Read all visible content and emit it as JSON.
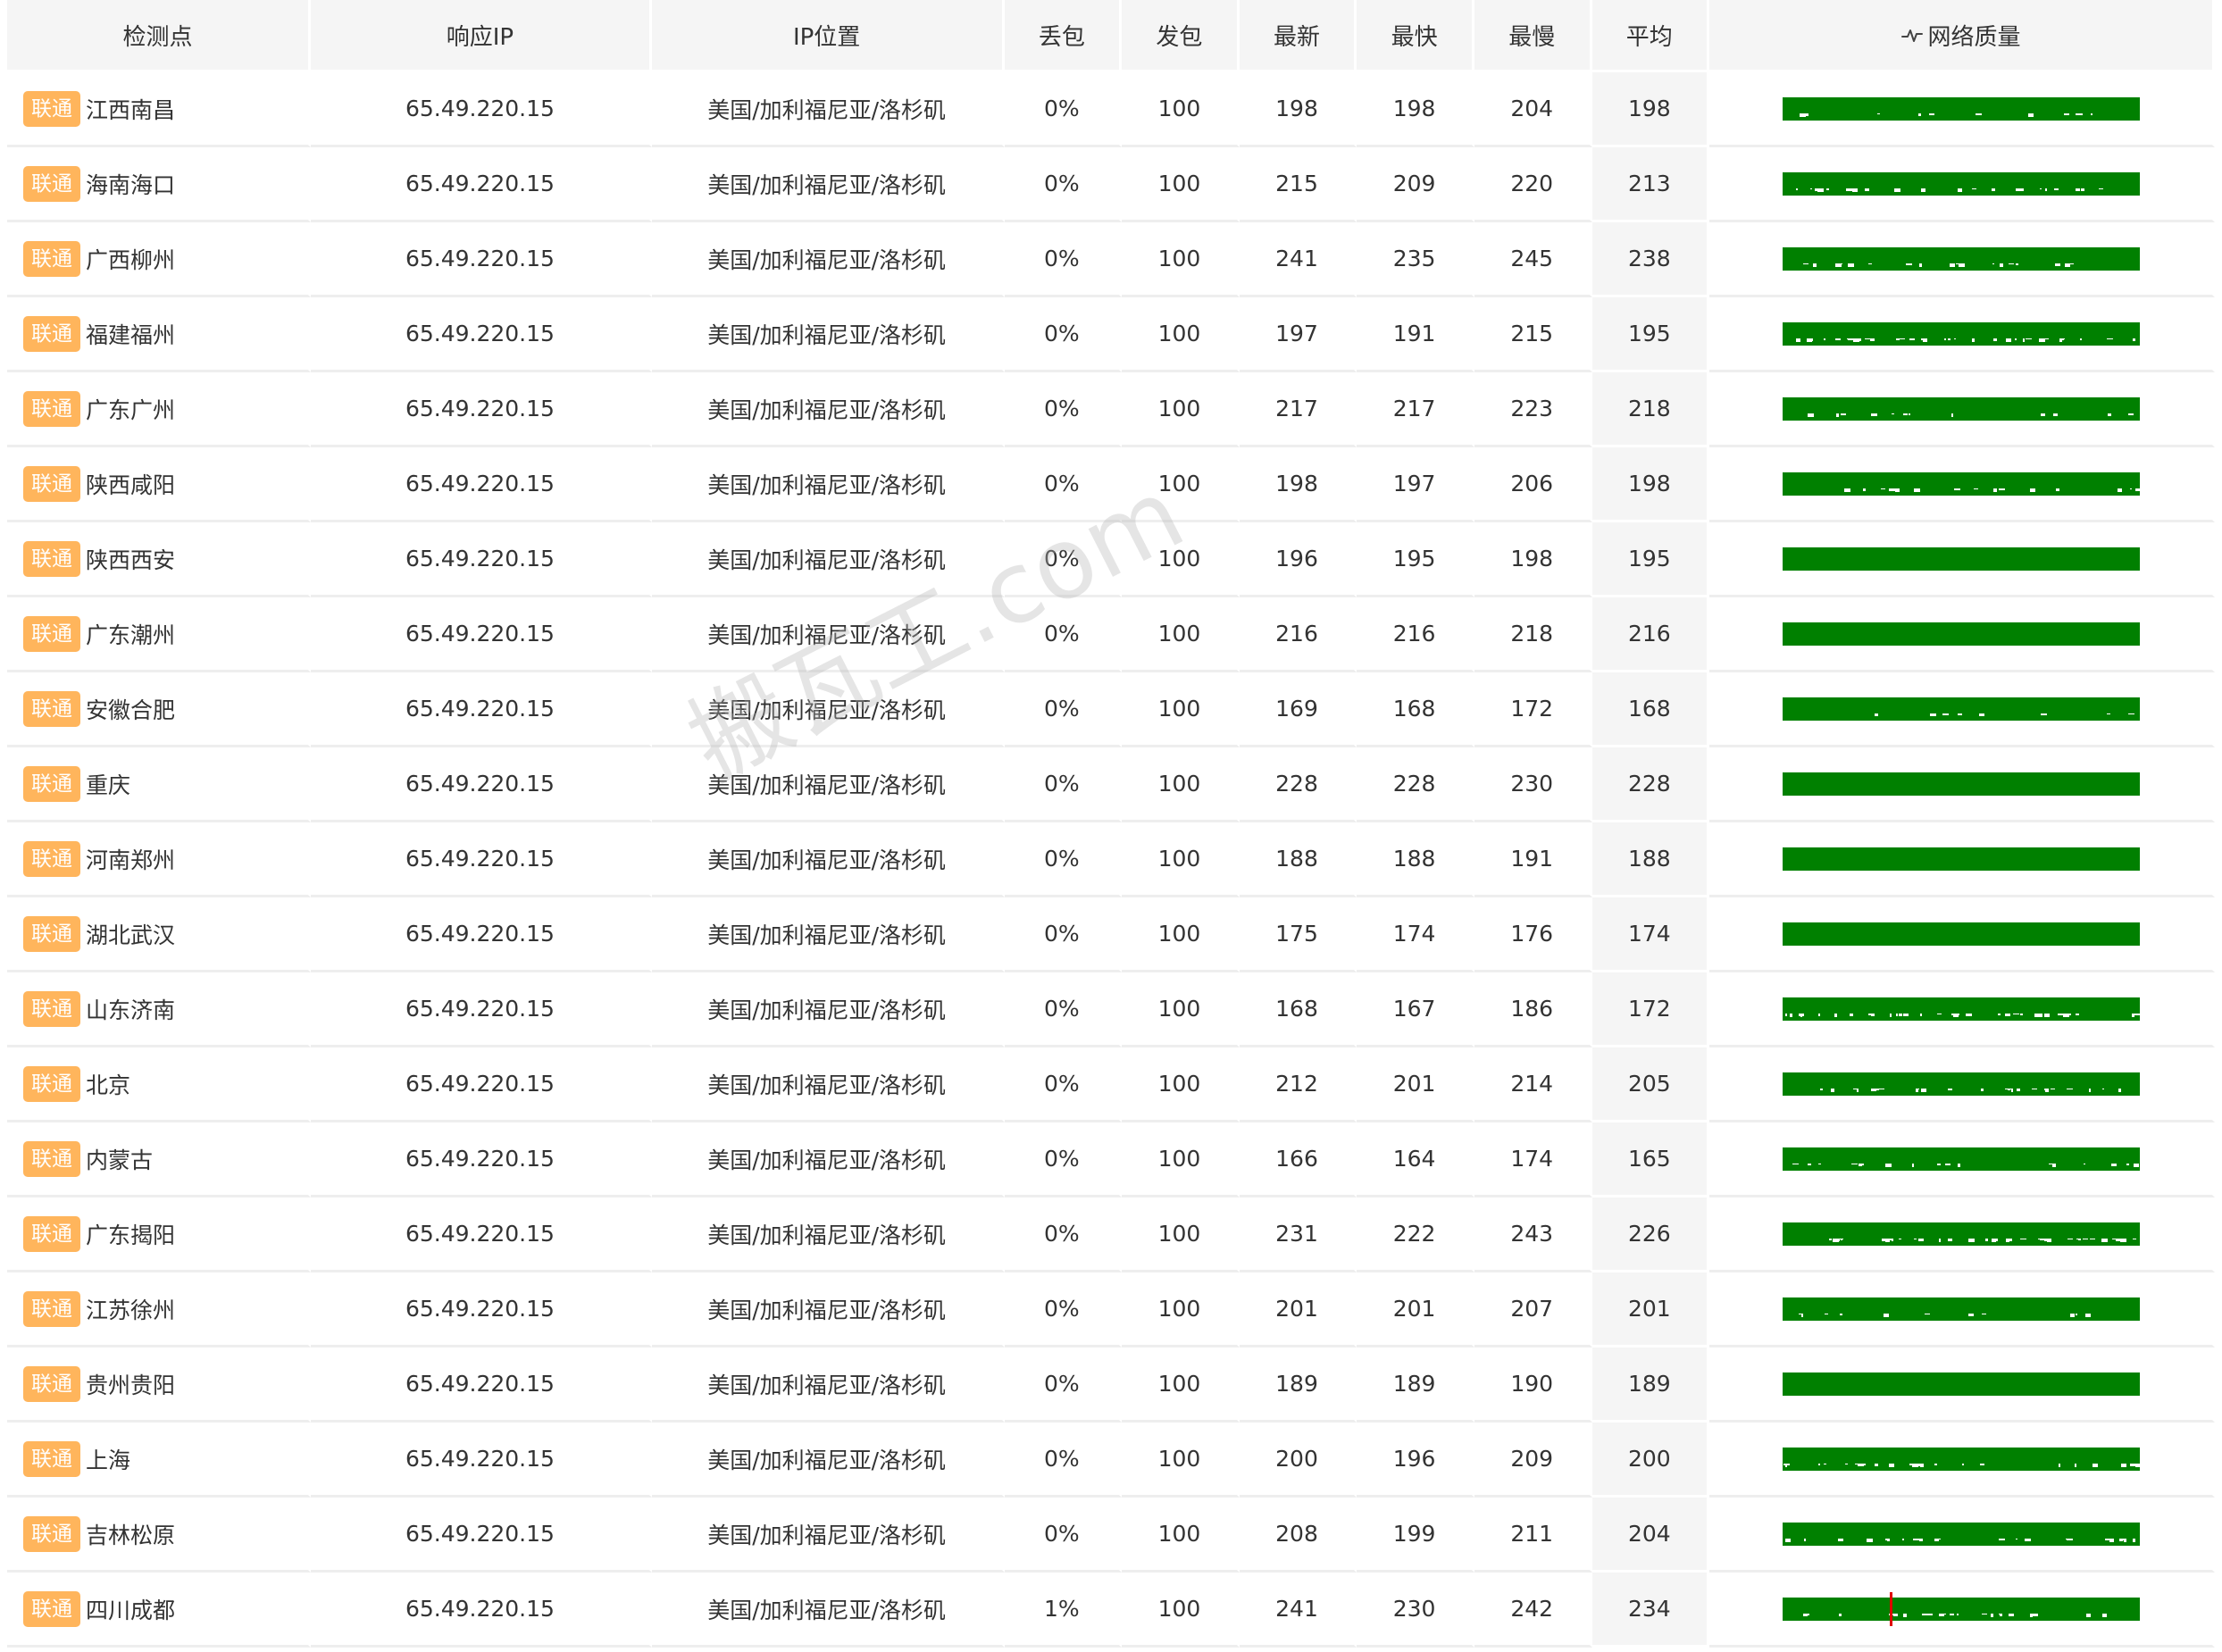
{
  "header": {
    "node": "检测点",
    "ip": "响应IP",
    "location": "IP位置",
    "loss": "丢包",
    "sent": "发包",
    "latest": "最新",
    "fastest": "最快",
    "slowest": "最慢",
    "average": "平均",
    "quality": "网络质量"
  },
  "watermark": "搬瓦工.com",
  "colors": {
    "badge": "#ffb55c",
    "quality_good": "#008000",
    "quality_loss": "#e00000",
    "header_bg": "#f5f5f5"
  },
  "rows": [
    {
      "isp": "联通",
      "node": "江西南昌",
      "ip": "65.49.220.15",
      "location": "美国/加利福尼亚/洛杉矶",
      "loss": "0%",
      "sent": "100",
      "latest": "198",
      "fastest": "198",
      "slowest": "204",
      "average": "198"
    },
    {
      "isp": "联通",
      "node": "海南海口",
      "ip": "65.49.220.15",
      "location": "美国/加利福尼亚/洛杉矶",
      "loss": "0%",
      "sent": "100",
      "latest": "215",
      "fastest": "209",
      "slowest": "220",
      "average": "213"
    },
    {
      "isp": "联通",
      "node": "广西柳州",
      "ip": "65.49.220.15",
      "location": "美国/加利福尼亚/洛杉矶",
      "loss": "0%",
      "sent": "100",
      "latest": "241",
      "fastest": "235",
      "slowest": "245",
      "average": "238"
    },
    {
      "isp": "联通",
      "node": "福建福州",
      "ip": "65.49.220.15",
      "location": "美国/加利福尼亚/洛杉矶",
      "loss": "0%",
      "sent": "100",
      "latest": "197",
      "fastest": "191",
      "slowest": "215",
      "average": "195"
    },
    {
      "isp": "联通",
      "node": "广东广州",
      "ip": "65.49.220.15",
      "location": "美国/加利福尼亚/洛杉矶",
      "loss": "0%",
      "sent": "100",
      "latest": "217",
      "fastest": "217",
      "slowest": "223",
      "average": "218"
    },
    {
      "isp": "联通",
      "node": "陕西咸阳",
      "ip": "65.49.220.15",
      "location": "美国/加利福尼亚/洛杉矶",
      "loss": "0%",
      "sent": "100",
      "latest": "198",
      "fastest": "197",
      "slowest": "206",
      "average": "198"
    },
    {
      "isp": "联通",
      "node": "陕西西安",
      "ip": "65.49.220.15",
      "location": "美国/加利福尼亚/洛杉矶",
      "loss": "0%",
      "sent": "100",
      "latest": "196",
      "fastest": "195",
      "slowest": "198",
      "average": "195"
    },
    {
      "isp": "联通",
      "node": "广东潮州",
      "ip": "65.49.220.15",
      "location": "美国/加利福尼亚/洛杉矶",
      "loss": "0%",
      "sent": "100",
      "latest": "216",
      "fastest": "216",
      "slowest": "218",
      "average": "216"
    },
    {
      "isp": "联通",
      "node": "安徽合肥",
      "ip": "65.49.220.15",
      "location": "美国/加利福尼亚/洛杉矶",
      "loss": "0%",
      "sent": "100",
      "latest": "169",
      "fastest": "168",
      "slowest": "172",
      "average": "168"
    },
    {
      "isp": "联通",
      "node": "重庆",
      "ip": "65.49.220.15",
      "location": "美国/加利福尼亚/洛杉矶",
      "loss": "0%",
      "sent": "100",
      "latest": "228",
      "fastest": "228",
      "slowest": "230",
      "average": "228"
    },
    {
      "isp": "联通",
      "node": "河南郑州",
      "ip": "65.49.220.15",
      "location": "美国/加利福尼亚/洛杉矶",
      "loss": "0%",
      "sent": "100",
      "latest": "188",
      "fastest": "188",
      "slowest": "191",
      "average": "188"
    },
    {
      "isp": "联通",
      "node": "湖北武汉",
      "ip": "65.49.220.15",
      "location": "美国/加利福尼亚/洛杉矶",
      "loss": "0%",
      "sent": "100",
      "latest": "175",
      "fastest": "174",
      "slowest": "176",
      "average": "174"
    },
    {
      "isp": "联通",
      "node": "山东济南",
      "ip": "65.49.220.15",
      "location": "美国/加利福尼亚/洛杉矶",
      "loss": "0%",
      "sent": "100",
      "latest": "168",
      "fastest": "167",
      "slowest": "186",
      "average": "172"
    },
    {
      "isp": "联通",
      "node": "北京",
      "ip": "65.49.220.15",
      "location": "美国/加利福尼亚/洛杉矶",
      "loss": "0%",
      "sent": "100",
      "latest": "212",
      "fastest": "201",
      "slowest": "214",
      "average": "205"
    },
    {
      "isp": "联通",
      "node": "内蒙古",
      "ip": "65.49.220.15",
      "location": "美国/加利福尼亚/洛杉矶",
      "loss": "0%",
      "sent": "100",
      "latest": "166",
      "fastest": "164",
      "slowest": "174",
      "average": "165"
    },
    {
      "isp": "联通",
      "node": "广东揭阳",
      "ip": "65.49.220.15",
      "location": "美国/加利福尼亚/洛杉矶",
      "loss": "0%",
      "sent": "100",
      "latest": "231",
      "fastest": "222",
      "slowest": "243",
      "average": "226"
    },
    {
      "isp": "联通",
      "node": "江苏徐州",
      "ip": "65.49.220.15",
      "location": "美国/加利福尼亚/洛杉矶",
      "loss": "0%",
      "sent": "100",
      "latest": "201",
      "fastest": "201",
      "slowest": "207",
      "average": "201"
    },
    {
      "isp": "联通",
      "node": "贵州贵阳",
      "ip": "65.49.220.15",
      "location": "美国/加利福尼亚/洛杉矶",
      "loss": "0%",
      "sent": "100",
      "latest": "189",
      "fastest": "189",
      "slowest": "190",
      "average": "189"
    },
    {
      "isp": "联通",
      "node": "上海",
      "ip": "65.49.220.15",
      "location": "美国/加利福尼亚/洛杉矶",
      "loss": "0%",
      "sent": "100",
      "latest": "200",
      "fastest": "196",
      "slowest": "209",
      "average": "200"
    },
    {
      "isp": "联通",
      "node": "吉林松原",
      "ip": "65.49.220.15",
      "location": "美国/加利福尼亚/洛杉矶",
      "loss": "0%",
      "sent": "100",
      "latest": "208",
      "fastest": "199",
      "slowest": "211",
      "average": "204"
    },
    {
      "isp": "联通",
      "node": "四川成都",
      "ip": "65.49.220.15",
      "location": "美国/加利福尼亚/洛杉矶",
      "loss": "1%",
      "sent": "100",
      "latest": "241",
      "fastest": "230",
      "slowest": "242",
      "average": "234",
      "loss_mark": 0.3
    }
  ]
}
